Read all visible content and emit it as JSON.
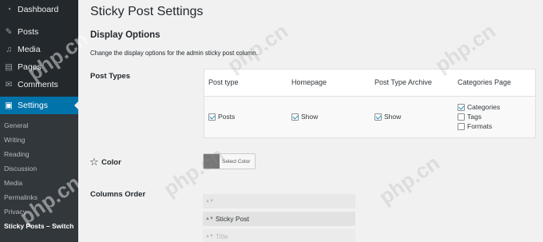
{
  "sidebar": {
    "items": [
      {
        "label": "Dashboard",
        "icon": "dashboard-icon",
        "glyph": "◔"
      },
      {
        "label": "Posts",
        "icon": "pin-icon",
        "glyph": "✎"
      },
      {
        "label": "Media",
        "icon": "media-icon",
        "glyph": "♫"
      },
      {
        "label": "Pages",
        "icon": "pages-icon",
        "glyph": "▤"
      },
      {
        "label": "Comments",
        "icon": "comments-icon",
        "glyph": "✉"
      },
      {
        "label": "Settings",
        "icon": "settings-icon",
        "glyph": "▣"
      }
    ],
    "submenu": [
      "General",
      "Writing",
      "Reading",
      "Discussion",
      "Media",
      "Permalinks",
      "Privacy",
      "Sticky Posts – Switch"
    ]
  },
  "page": {
    "title": "Sticky Post Settings",
    "section_title": "Display Options",
    "section_desc": "Change the display options for the admin sticky post column."
  },
  "post_types": {
    "label": "Post Types",
    "headers": [
      "Post type",
      "Homepage",
      "Post Type Archive",
      "Categories Page"
    ],
    "row": {
      "post_type": {
        "label": "Posts",
        "checked": true
      },
      "homepage": {
        "label": "Show",
        "checked": true
      },
      "archive": {
        "label": "Show",
        "checked": true
      },
      "categories": [
        {
          "label": "Categories",
          "checked": true
        },
        {
          "label": "Tags",
          "checked": false
        },
        {
          "label": "Formats",
          "checked": false
        }
      ]
    }
  },
  "color": {
    "label": "Color",
    "button_label": "Select Color",
    "swatch": "#777777"
  },
  "columns_order": {
    "label": "Columns Order",
    "items": [
      "",
      "Sticky Post",
      "Title"
    ]
  },
  "watermark": "php.cn",
  "colors": {
    "sidebar_bg": "#23282d",
    "submenu_bg": "#32373c",
    "accent": "#0073aa",
    "checkbox_check": "#1e8cbe"
  }
}
